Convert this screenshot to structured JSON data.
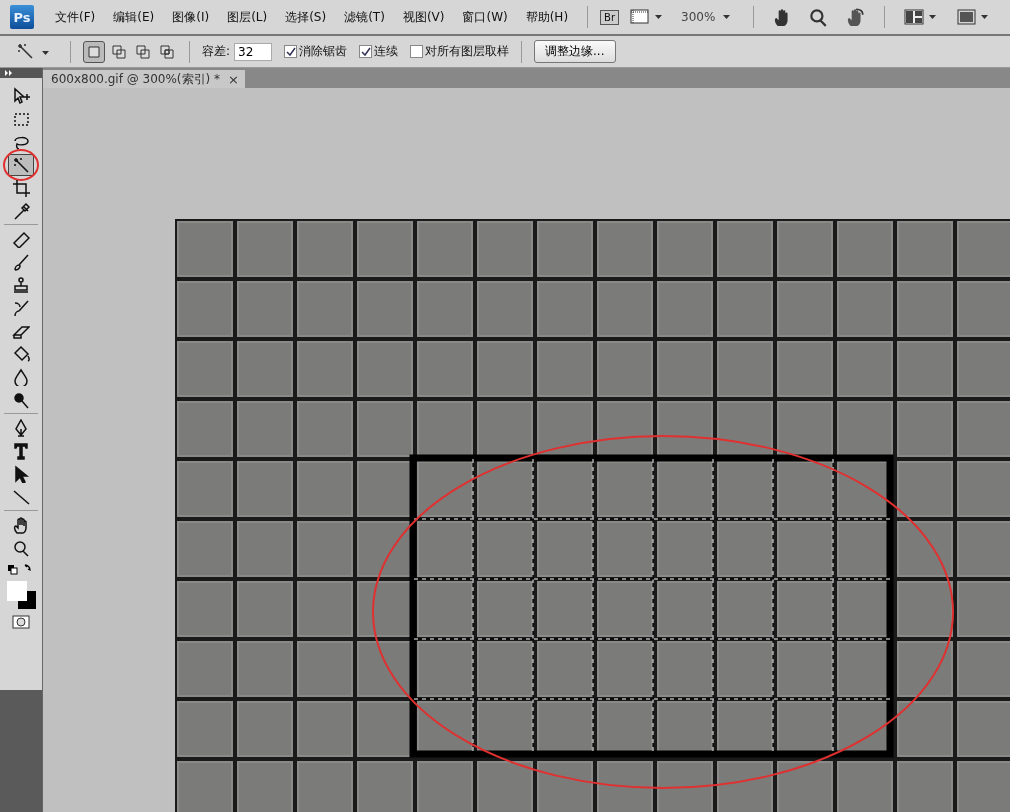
{
  "app": {
    "logo": "Ps"
  },
  "menu": [
    "文件(F)",
    "编辑(E)",
    "图像(I)",
    "图层(L)",
    "选择(S)",
    "滤镜(T)",
    "视图(V)",
    "窗口(W)",
    "帮助(H)"
  ],
  "app_bar": {
    "bridge": "Br",
    "zoom": "300%"
  },
  "options": {
    "modes": [
      {
        "kind": "new",
        "selected": true
      },
      {
        "kind": "add",
        "selected": false
      },
      {
        "kind": "subtract",
        "selected": false
      },
      {
        "kind": "intersect",
        "selected": false
      }
    ],
    "tolerance_label": "容差:",
    "tolerance": "32",
    "checkboxes": [
      {
        "label": "消除锯齿",
        "checked": true
      },
      {
        "label": "连续",
        "checked": true
      },
      {
        "label": "对所有图层取样",
        "checked": false
      }
    ],
    "refine_button": "调整边缘..."
  },
  "document_tab": {
    "title": "600x800.gif @ 300%(索引) *",
    "close": "×"
  },
  "tools": [
    {
      "kind": "move",
      "selected": false
    },
    {
      "kind": "marquee",
      "selected": false
    },
    {
      "kind": "lasso",
      "selected": false
    },
    {
      "kind": "wand",
      "selected": true
    },
    {
      "kind": "crop",
      "selected": false
    },
    {
      "kind": "eyedropper",
      "selected": false
    },
    {
      "kind": "sep"
    },
    {
      "kind": "healing",
      "selected": false
    },
    {
      "kind": "brush",
      "selected": false
    },
    {
      "kind": "stamp",
      "selected": false
    },
    {
      "kind": "history",
      "selected": false
    },
    {
      "kind": "eraser",
      "selected": false
    },
    {
      "kind": "bucket",
      "selected": false
    },
    {
      "kind": "blur",
      "selected": false
    },
    {
      "kind": "dodge",
      "selected": false
    },
    {
      "kind": "sep"
    },
    {
      "kind": "pen",
      "selected": false
    },
    {
      "kind": "type",
      "selected": false
    },
    {
      "kind": "path",
      "selected": false
    },
    {
      "kind": "line",
      "selected": false
    },
    {
      "kind": "sep"
    },
    {
      "kind": "hand",
      "selected": false
    },
    {
      "kind": "zoom",
      "selected": false
    }
  ]
}
